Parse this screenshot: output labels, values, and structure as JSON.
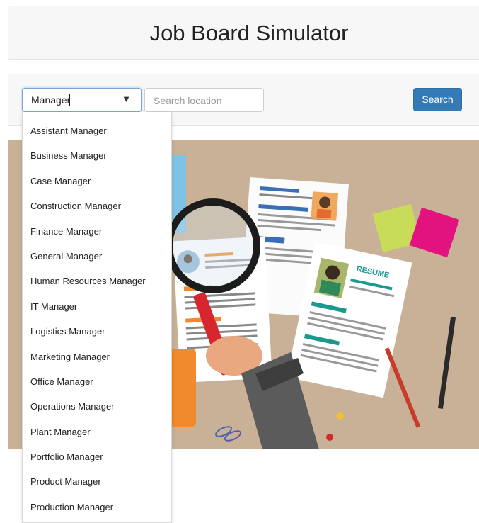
{
  "header": {
    "title": "Job Board Simulator"
  },
  "search": {
    "job_value": "Manager",
    "location_placeholder": "Search location",
    "button_label": "Search",
    "dropdown_arrow": "▼"
  },
  "dropdown": {
    "items": [
      "Assistant Manager",
      "Business Manager",
      "Case Manager",
      "Construction Manager",
      "Finance Manager",
      "General Manager",
      "Human Resources Manager",
      "IT Manager",
      "Logistics Manager",
      "Marketing Manager",
      "Office Manager",
      "Operations Manager",
      "Plant Manager",
      "Portfolio Manager",
      "Product Manager",
      "Production Manager"
    ]
  },
  "hero": {
    "resume_stamp": "RESUME"
  },
  "colors": {
    "accent": "#337ab7",
    "hero_background": "#c9b197",
    "sticky_note_green": "#c8dc5a",
    "sticky_note_pink": "#e2137f"
  }
}
